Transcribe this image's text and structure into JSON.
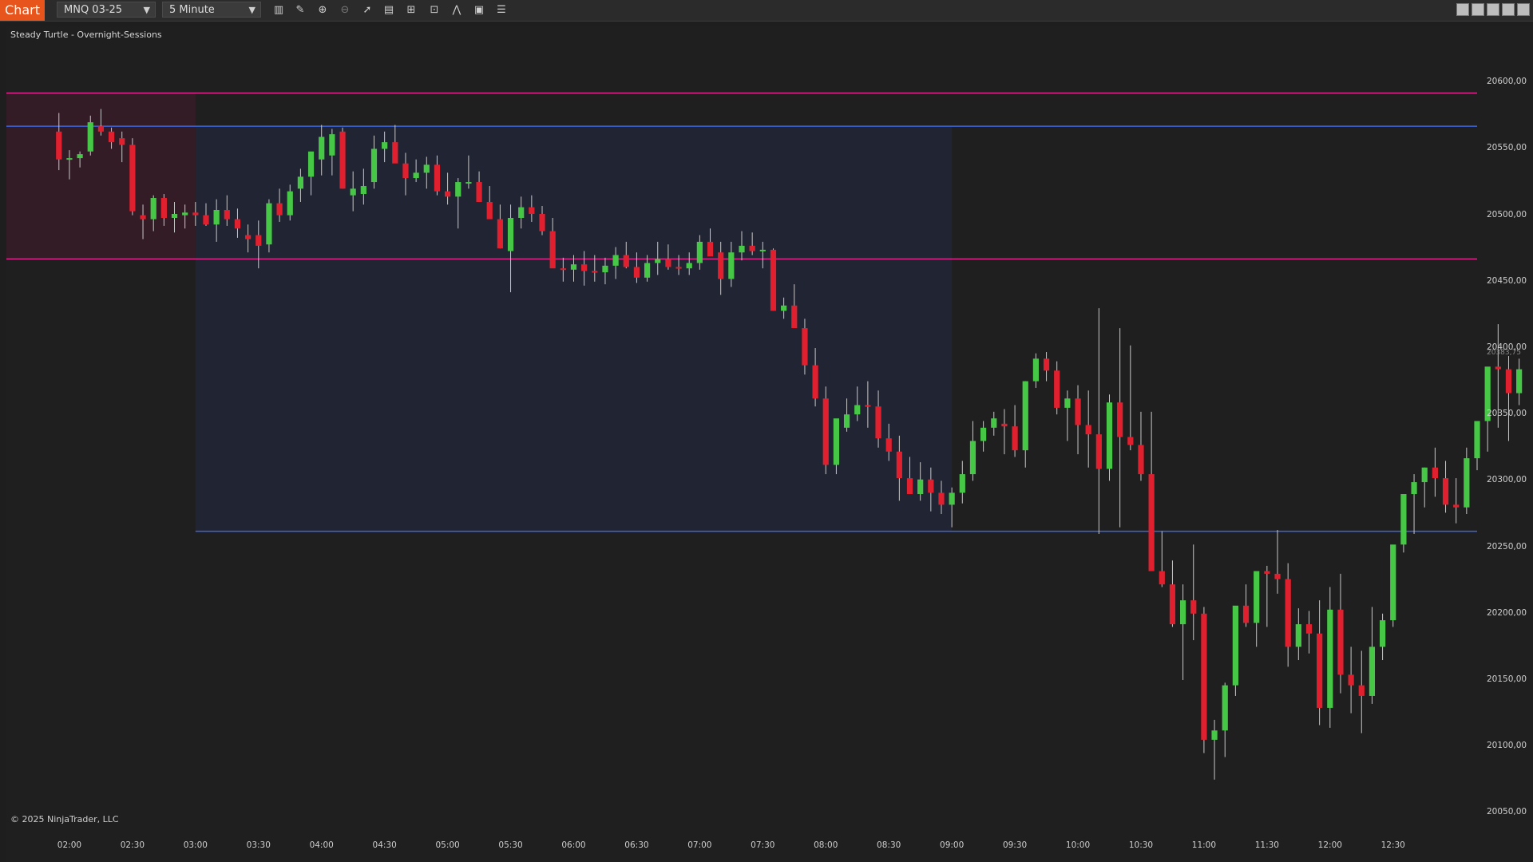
{
  "toolbar": {
    "chart_tab": "Chart",
    "instrument": "MNQ 03-25",
    "interval": "5 Minute",
    "icons": [
      "bar-type-icon",
      "drawing-tool-icon",
      "zoom-in-icon",
      "zoom-out-icon",
      "pointer-icon",
      "data-box-icon",
      "chart-trader-icon",
      "properties-icon",
      "strategies-icon",
      "templates-icon",
      "list-icon"
    ],
    "window_buttons": [
      "tile-icon",
      "restore-icon",
      "minimize-icon",
      "maximize-icon",
      "close-icon"
    ]
  },
  "chart_label": "Steady Turtle - Overnight-Sessions",
  "copyright": "© 2025 NinjaTrader, LLC",
  "price_marker": "20383,75",
  "colors": {
    "up": "#46c846",
    "down": "#e0202e",
    "background": "#1f1f1f",
    "magenta_level": "#e0288c",
    "blue_level": "#3c64dc",
    "zone_a": "#331c26",
    "zone_b": "#212433"
  },
  "chart_data": {
    "type": "candlestick",
    "title": "Steady Turtle - Overnight-Sessions",
    "y_ticks": [
      "20600,00",
      "20550,00",
      "20500,00",
      "20450,00",
      "20400,00",
      "20350,00",
      "20300,00",
      "20250,00",
      "20200,00",
      "20150,00",
      "20100,00",
      "20050,00"
    ],
    "x_ticks": [
      "02:00",
      "02:30",
      "03:00",
      "03:30",
      "04:00",
      "04:30",
      "05:00",
      "05:30",
      "06:00",
      "06:30",
      "07:00",
      "07:30",
      "08:00",
      "08:30",
      "09:00",
      "09:30",
      "10:00",
      "10:30",
      "11:00",
      "11:30",
      "12:00",
      "12:30"
    ],
    "ylim": [
      20040,
      20620
    ],
    "xlim_minutes": [
      90,
      790
    ],
    "levels": [
      {
        "price": 20592,
        "color": "magenta"
      },
      {
        "price": 20567,
        "color": "blue"
      },
      {
        "price": 20467,
        "color": "magenta"
      },
      {
        "price": 20262,
        "color": "blue"
      }
    ],
    "zones": [
      {
        "from": "01:10",
        "to": "03:00",
        "low": 20467,
        "high": 20592,
        "color": "zone_a"
      },
      {
        "from": "03:00",
        "to": "09:00",
        "low": 20262,
        "high": 20567,
        "color": "zone_b"
      }
    ],
    "candles": [
      [
        20563,
        20577,
        20534,
        20542
      ],
      [
        20542,
        20549,
        20527,
        20543
      ],
      [
        20543,
        20548,
        20536,
        20546
      ],
      [
        20548,
        20575,
        20545,
        20570
      ],
      [
        20567,
        20580,
        20560,
        20563
      ],
      [
        20563,
        20566,
        20550,
        20555
      ],
      [
        20558,
        20563,
        20540,
        20553
      ],
      [
        20553,
        20558,
        20500,
        20503
      ],
      [
        20500,
        20508,
        20482,
        20497
      ],
      [
        20497,
        20515,
        20488,
        20513
      ],
      [
        20513,
        20516,
        20492,
        20498
      ],
      [
        20498,
        20510,
        20487,
        20501
      ],
      [
        20500,
        20508,
        20490,
        20502
      ],
      [
        20502,
        20510,
        20492,
        20500
      ],
      [
        20500,
        20509,
        20492,
        20493
      ],
      [
        20493,
        20512,
        20480,
        20504
      ],
      [
        20504,
        20515,
        20492,
        20497
      ],
      [
        20497,
        20505,
        20483,
        20490
      ],
      [
        20485,
        20493,
        20472,
        20482
      ],
      [
        20485,
        20496,
        20460,
        20477
      ],
      [
        20478,
        20512,
        20472,
        20509
      ],
      [
        20509,
        20520,
        20495,
        20500
      ],
      [
        20500,
        20523,
        20496,
        20518
      ],
      [
        20520,
        20535,
        20510,
        20529
      ],
      [
        20529,
        20540,
        20515,
        20548
      ],
      [
        20542,
        20568,
        20530,
        20559
      ],
      [
        20545,
        20565,
        20530,
        20561
      ],
      [
        20563,
        20566,
        20520,
        20520
      ],
      [
        20515,
        20533,
        20503,
        20520
      ],
      [
        20516,
        20535,
        20508,
        20522
      ],
      [
        20525,
        20560,
        20520,
        20550
      ],
      [
        20550,
        20563,
        20540,
        20555
      ],
      [
        20555,
        20568,
        20540,
        20539
      ],
      [
        20539,
        20547,
        20515,
        20528
      ],
      [
        20528,
        20542,
        20525,
        20532
      ],
      [
        20532,
        20544,
        20520,
        20538
      ],
      [
        20538,
        20545,
        20515,
        20518
      ],
      [
        20518,
        20532,
        20508,
        20514
      ],
      [
        20514,
        20528,
        20490,
        20525
      ],
      [
        20525,
        20545,
        20520,
        20525
      ],
      [
        20525,
        20533,
        20510,
        20510
      ],
      [
        20510,
        20522,
        20500,
        20497
      ],
      [
        20497,
        20508,
        20475,
        20475
      ],
      [
        20473,
        20508,
        20442,
        20498
      ],
      [
        20498,
        20514,
        20490,
        20506
      ],
      [
        20506,
        20515,
        20495,
        20501
      ],
      [
        20501,
        20507,
        20485,
        20488
      ],
      [
        20488,
        20498,
        20475,
        20460
      ],
      [
        20460,
        20468,
        20450,
        20459
      ],
      [
        20459,
        20470,
        20450,
        20463
      ],
      [
        20463,
        20473,
        20447,
        20458
      ],
      [
        20458,
        20470,
        20450,
        20457
      ],
      [
        20457,
        20468,
        20448,
        20462
      ],
      [
        20462,
        20476,
        20452,
        20470
      ],
      [
        20470,
        20480,
        20460,
        20461
      ],
      [
        20461,
        20472,
        20449,
        20453
      ],
      [
        20453,
        20470,
        20450,
        20464
      ],
      [
        20464,
        20480,
        20455,
        20467
      ],
      [
        20467,
        20478,
        20459,
        20461
      ],
      [
        20461,
        20470,
        20455,
        20460
      ],
      [
        20460,
        20472,
        20455,
        20464
      ],
      [
        20464,
        20485,
        20459,
        20480
      ],
      [
        20480,
        20490,
        20470,
        20469
      ],
      [
        20472,
        20480,
        20440,
        20452
      ],
      [
        20452,
        20480,
        20446,
        20472
      ],
      [
        20472,
        20488,
        20466,
        20477
      ],
      [
        20477,
        20487,
        20470,
        20473
      ],
      [
        20473,
        20480,
        20460,
        20474
      ],
      [
        20474,
        20475,
        20428,
        20428
      ],
      [
        20428,
        20438,
        20422,
        20432
      ],
      [
        20432,
        20448,
        20418,
        20415
      ],
      [
        20415,
        20422,
        20380,
        20387
      ],
      [
        20387,
        20400,
        20356,
        20362
      ],
      [
        20362,
        20371,
        20305,
        20312
      ],
      [
        20312,
        20342,
        20305,
        20347
      ],
      [
        20340,
        20362,
        20337,
        20350
      ],
      [
        20350,
        20371,
        20345,
        20357
      ],
      [
        20357,
        20375,
        20340,
        20356
      ],
      [
        20356,
        20368,
        20325,
        20332
      ],
      [
        20332,
        20343,
        20315,
        20322
      ],
      [
        20322,
        20334,
        20285,
        20302
      ],
      [
        20302,
        20318,
        20292,
        20290
      ],
      [
        20290,
        20314,
        20285,
        20301
      ],
      [
        20301,
        20310,
        20277,
        20291
      ],
      [
        20291,
        20300,
        20275,
        20282
      ],
      [
        20282,
        20295,
        20265,
        20291
      ],
      [
        20291,
        20315,
        20283,
        20305
      ],
      [
        20305,
        20345,
        20300,
        20330
      ],
      [
        20330,
        20345,
        20322,
        20340
      ],
      [
        20340,
        20352,
        20334,
        20347
      ],
      [
        20343,
        20354,
        20320,
        20341
      ],
      [
        20341,
        20357,
        20318,
        20323
      ],
      [
        20323,
        20375,
        20310,
        20375
      ],
      [
        20375,
        20396,
        20370,
        20392
      ],
      [
        20392,
        20397,
        20375,
        20383
      ],
      [
        20383,
        20390,
        20350,
        20355
      ],
      [
        20355,
        20368,
        20330,
        20362
      ],
      [
        20362,
        20372,
        20320,
        20342
      ],
      [
        20342,
        20368,
        20310,
        20335
      ],
      [
        20335,
        20430,
        20260,
        20309
      ],
      [
        20309,
        20365,
        20300,
        20359
      ],
      [
        20359,
        20415,
        20265,
        20333
      ],
      [
        20333,
        20402,
        20323,
        20327
      ],
      [
        20327,
        20352,
        20300,
        20305
      ],
      [
        20305,
        20352,
        20268,
        20232
      ],
      [
        20232,
        20262,
        20220,
        20222
      ],
      [
        20222,
        20240,
        20190,
        20192
      ],
      [
        20192,
        20222,
        20150,
        20210
      ],
      [
        20210,
        20252,
        20180,
        20200
      ],
      [
        20200,
        20205,
        20095,
        20105
      ],
      [
        20105,
        20120,
        20075,
        20112
      ],
      [
        20112,
        20148,
        20092,
        20146
      ],
      [
        20146,
        20200,
        20138,
        20206
      ],
      [
        20206,
        20222,
        20190,
        20193
      ],
      [
        20193,
        20231,
        20175,
        20232
      ],
      [
        20232,
        20236,
        20190,
        20230
      ],
      [
        20230,
        20263,
        20215,
        20226
      ],
      [
        20226,
        20238,
        20160,
        20175
      ],
      [
        20175,
        20204,
        20165,
        20192
      ],
      [
        20192,
        20202,
        20170,
        20185
      ],
      [
        20185,
        20210,
        20116,
        20129
      ],
      [
        20129,
        20220,
        20114,
        20203
      ],
      [
        20203,
        20230,
        20140,
        20154
      ],
      [
        20154,
        20175,
        20125,
        20146
      ],
      [
        20146,
        20172,
        20110,
        20138
      ],
      [
        20138,
        20205,
        20132,
        20175
      ],
      [
        20175,
        20200,
        20165,
        20195
      ],
      [
        20195,
        20251,
        20190,
        20252
      ],
      [
        20252,
        20280,
        20246,
        20290
      ],
      [
        20290,
        20305,
        20260,
        20299
      ],
      [
        20299,
        20310,
        20280,
        20310
      ],
      [
        20310,
        20325,
        20288,
        20302
      ],
      [
        20302,
        20315,
        20276,
        20282
      ],
      [
        20282,
        20302,
        20268,
        20280
      ],
      [
        20280,
        20325,
        20275,
        20317
      ],
      [
        20317,
        20344,
        20308,
        20345
      ],
      [
        20345,
        20383,
        20322,
        20386
      ],
      [
        20386,
        20418,
        20340,
        20384
      ],
      [
        20384,
        20394,
        20330,
        20366
      ],
      [
        20366,
        20392,
        20357,
        20384
      ]
    ]
  }
}
